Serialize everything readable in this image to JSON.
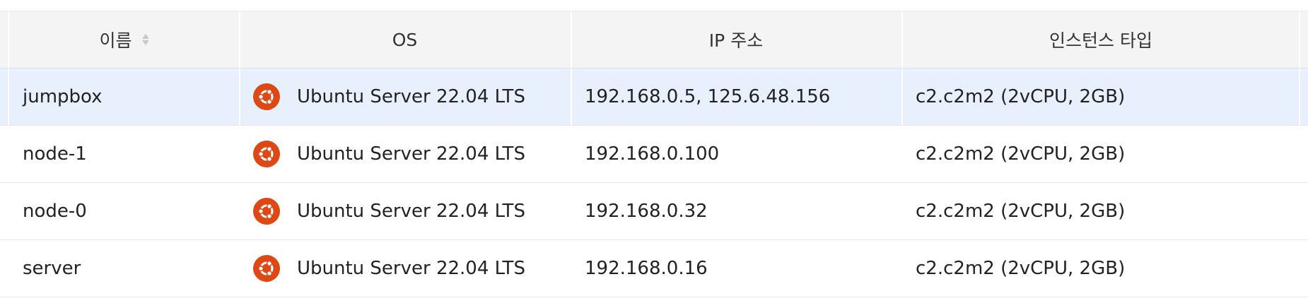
{
  "table": {
    "headers": {
      "name": "이름",
      "os": "OS",
      "ip": "IP 주소",
      "instance_type": "인스턴스 타입"
    },
    "rows": [
      {
        "name": "jumpbox",
        "os": "Ubuntu Server 22.04 LTS",
        "os_icon": "ubuntu-icon",
        "ip": "192.168.0.5, 125.6.48.156",
        "instance_type": "c2.c2m2 (2vCPU, 2GB)",
        "selected": true
      },
      {
        "name": "node-1",
        "os": "Ubuntu Server 22.04 LTS",
        "os_icon": "ubuntu-icon",
        "ip": "192.168.0.100",
        "instance_type": "c2.c2m2 (2vCPU, 2GB)",
        "selected": false
      },
      {
        "name": "node-0",
        "os": "Ubuntu Server 22.04 LTS",
        "os_icon": "ubuntu-icon",
        "ip": "192.168.0.32",
        "instance_type": "c2.c2m2 (2vCPU, 2GB)",
        "selected": false
      },
      {
        "name": "server",
        "os": "Ubuntu Server 22.04 LTS",
        "os_icon": "ubuntu-icon",
        "ip": "192.168.0.16",
        "instance_type": "c2.c2m2 (2vCPU, 2GB)",
        "selected": false
      }
    ]
  },
  "colors": {
    "header_bg": "#f4f4f4",
    "selected_row_bg": "#e8f0fd",
    "ubuntu_orange": "#dd4814"
  }
}
